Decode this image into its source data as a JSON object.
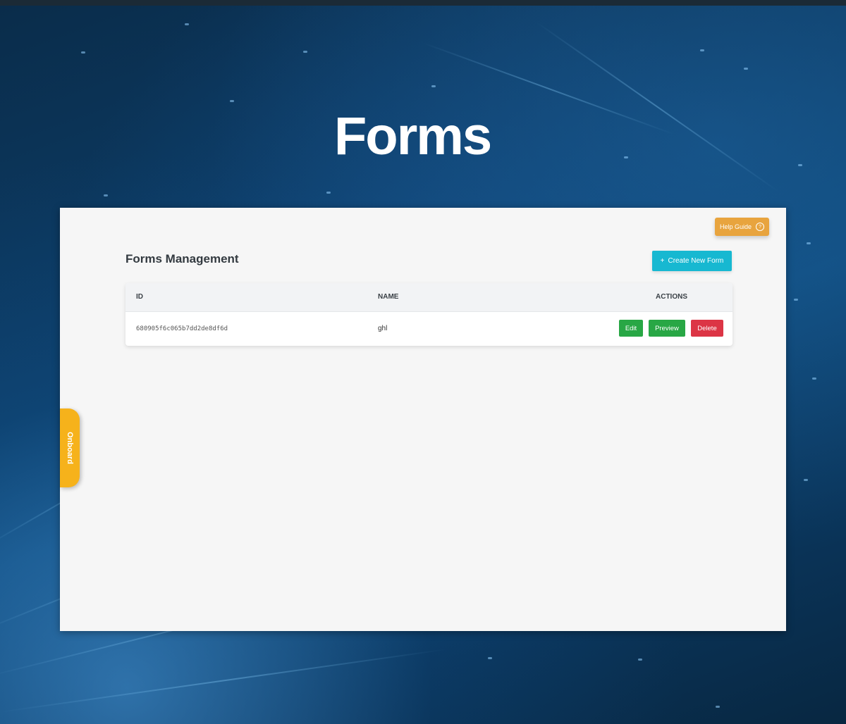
{
  "hero": {
    "title": "Forms"
  },
  "panel": {
    "help_label": "Help Guide",
    "help_icon_char": "?",
    "title": "Forms Management",
    "create_icon_char": "+",
    "create_label": "Create New Form"
  },
  "table": {
    "headers": {
      "id": "ID",
      "name": "NAME",
      "actions": "ACTIONS"
    },
    "rows": [
      {
        "id": "680905f6c065b7dd2de8df6d",
        "name": "ghl",
        "edit_label": "Edit",
        "preview_label": "Preview",
        "delete_label": "Delete"
      }
    ]
  },
  "onboard": {
    "label": "Onboard"
  },
  "colors": {
    "help_button": "#e8a43e",
    "create_button": "#17b8d1",
    "edit_button": "#28a745",
    "preview_button": "#28a745",
    "delete_button": "#dc3545",
    "onboard_tab": "#f6b21b"
  }
}
